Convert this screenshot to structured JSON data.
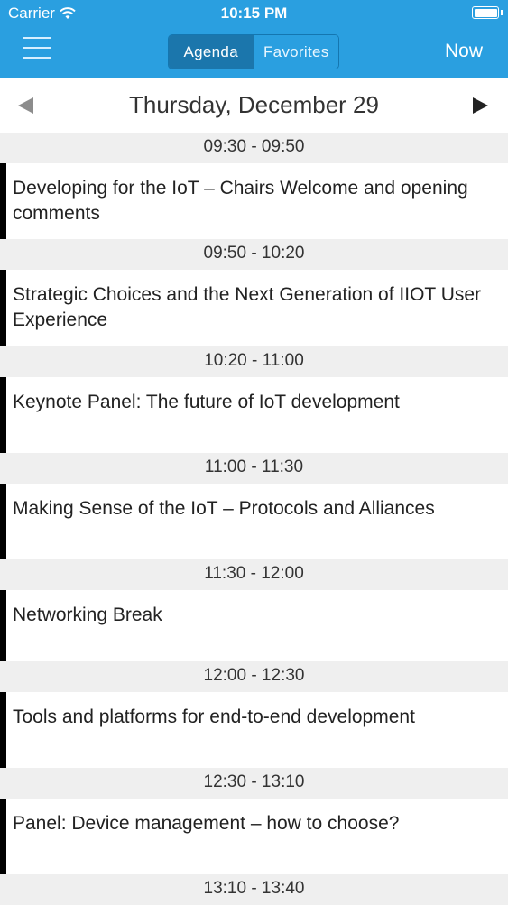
{
  "status_bar": {
    "carrier": "Carrier",
    "time": "10:15 PM"
  },
  "nav": {
    "segments": [
      {
        "label": "Agenda",
        "active": true
      },
      {
        "label": "Favorites",
        "active": false
      }
    ],
    "now_label": "Now"
  },
  "date": {
    "title": "Thursday, December 29"
  },
  "sessions": [
    {
      "time": "09:30 - 09:50",
      "title": "Developing for the IoT – Chairs Welcome and opening comments"
    },
    {
      "time": "09:50 - 10:20",
      "title": "Strategic Choices and the Next Generation of IIOT User Experience"
    },
    {
      "time": "10:20 - 11:00",
      "title": "Keynote Panel: The future of IoT development"
    },
    {
      "time": "11:00 - 11:30",
      "title": "Making Sense of the IoT – Protocols and Alliances"
    },
    {
      "time": "11:30 - 12:00",
      "title": "Networking Break"
    },
    {
      "time": "12:00 - 12:30",
      "title": "Tools and platforms for end-to-end development"
    },
    {
      "time": "12:30 - 13:10",
      "title": "Panel: Device management – how to choose?"
    },
    {
      "time": "13:10 - 13:40",
      "title": ""
    }
  ],
  "colors": {
    "header": "#2a9fe0",
    "segment_active": "#1b76ac",
    "session_marker": "#000000"
  }
}
